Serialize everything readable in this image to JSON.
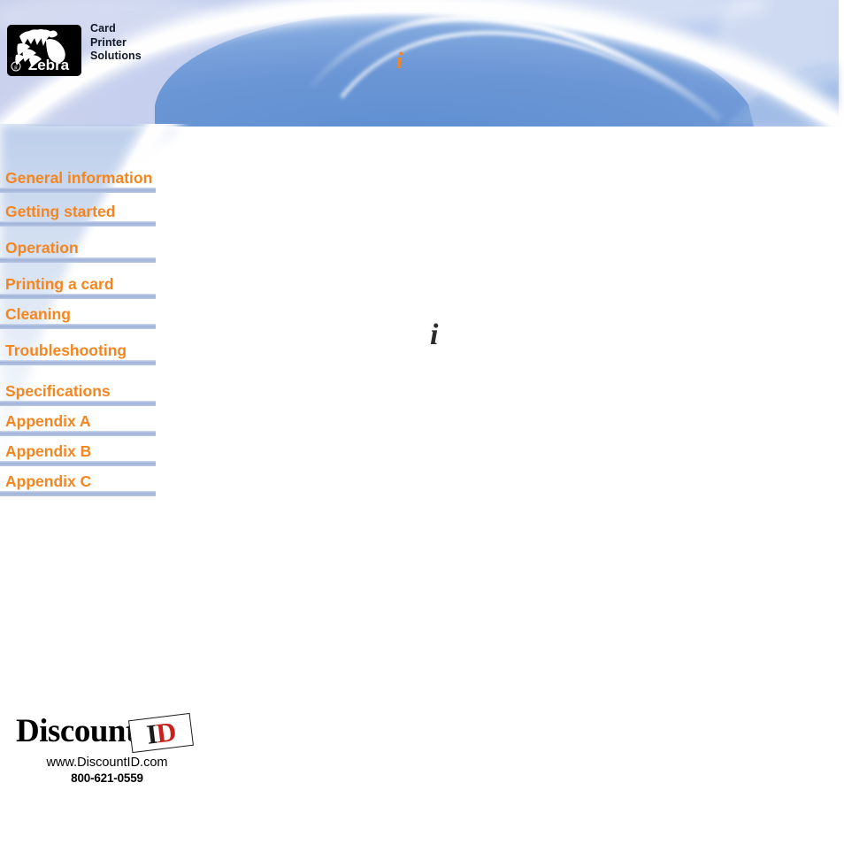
{
  "document": {
    "title": "Zebra Card Printer Solutions",
    "colors": {
      "banner_blue": "#6E99D6",
      "banner_light_blue": "#C2D0EE",
      "banner_pale": "#CBD2EC",
      "menu_orange": "#F5851F",
      "menu_rule_blue": "#9FB2D8",
      "logo_black": "#000000",
      "discount_red": "#C8201D"
    }
  },
  "header": {
    "logo": {
      "mark_name": "zebra-head-logo",
      "mark_alt": "Zebra",
      "registered_mark": "®",
      "wordmark": "Zebra",
      "tagline_lines": [
        "Card",
        "Printer",
        "Solutions"
      ]
    },
    "info_glyph": "i"
  },
  "content": {
    "info_glyph": "i"
  },
  "menu": {
    "items": [
      {
        "label": "General information"
      },
      {
        "label": "Getting started"
      },
      {
        "label": "Operation"
      },
      {
        "label": "Printing a card"
      },
      {
        "label": "Cleaning"
      },
      {
        "label": "Troubleshooting"
      },
      {
        "label": "Specifications"
      },
      {
        "label": "Appendix A"
      },
      {
        "label": "Appendix B"
      },
      {
        "label": "Appendix C"
      }
    ]
  },
  "footer": {
    "brand_word": "Discount",
    "brand_id_i": "I",
    "brand_id_d": "D",
    "website": "www.DiscountID.com",
    "phone": "800-621-0559"
  }
}
